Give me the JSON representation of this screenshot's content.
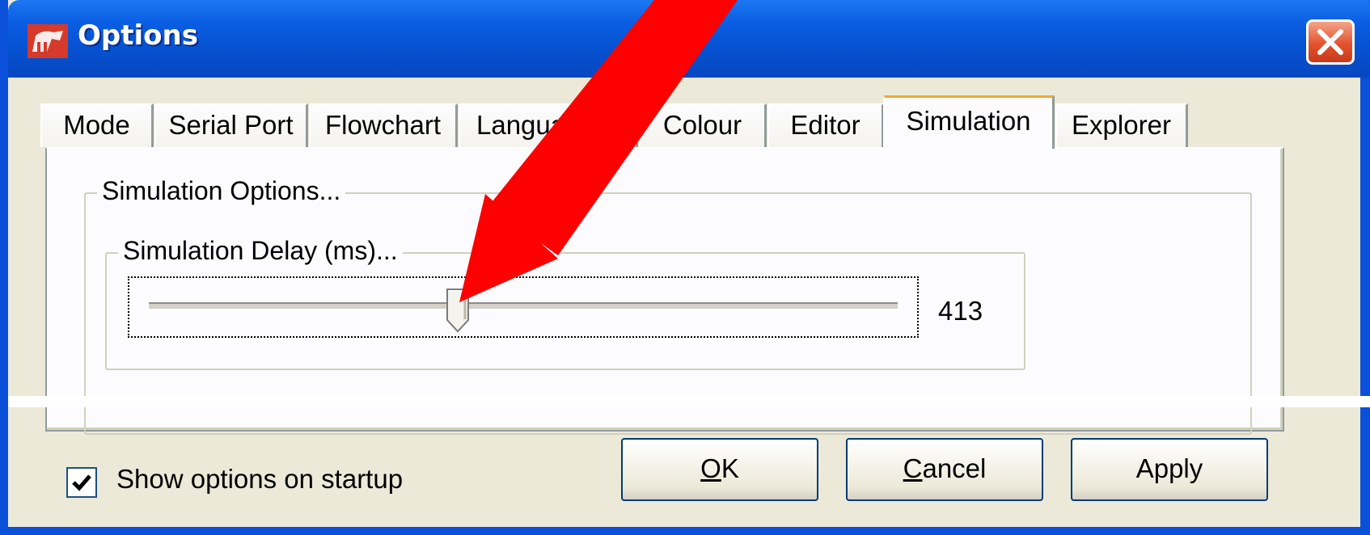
{
  "window": {
    "title": "Options",
    "icon": "flowchart-app-icon",
    "close_icon": "close-x-icon"
  },
  "tabs": [
    {
      "label": "Mode",
      "active": false
    },
    {
      "label": "Serial Port",
      "active": false
    },
    {
      "label": "Flowchart",
      "active": false
    },
    {
      "label": "Langua",
      "active": false
    },
    {
      "label": "Colour",
      "active": false
    },
    {
      "label": "Editor",
      "active": false
    },
    {
      "label": "Simulation",
      "active": true
    },
    {
      "label": "Explorer",
      "active": false
    }
  ],
  "simulation": {
    "group_title": "Simulation Options...",
    "delay_group_title": "Simulation Delay (ms)...",
    "delay_value": "413",
    "slider_fraction": 0.413
  },
  "footer": {
    "show_on_startup_label": "Show options on startup",
    "show_on_startup_checked": true,
    "ok_label_first": "O",
    "ok_label_rest": "K",
    "cancel_label_first": "C",
    "cancel_label_rest": "ancel",
    "apply_label": "Apply"
  },
  "colors": {
    "titlebar": "#0652d2",
    "dialog_bg": "#ece9d8",
    "active_tab_highlight": "#f1a63a",
    "annotation_arrow": "#ff0000"
  }
}
